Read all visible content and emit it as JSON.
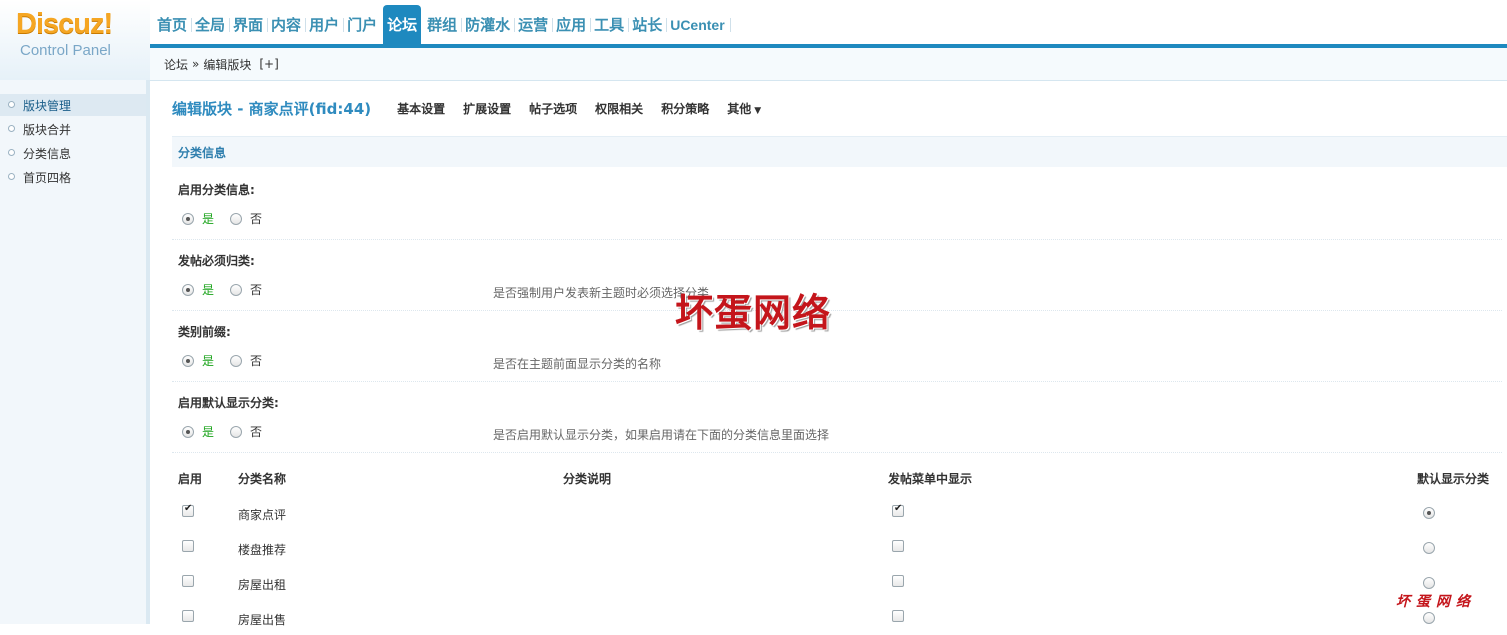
{
  "header": {
    "logo_text": "Discuz!",
    "logo_sub": "Control Panel",
    "nav": [
      "首页",
      "全局",
      "界面",
      "内容",
      "用户",
      "门户",
      "论坛",
      "群组",
      "防灌水",
      "运营",
      "应用",
      "工具",
      "站长",
      "UCenter"
    ],
    "active_nav": "论坛"
  },
  "breadcrumb": {
    "root": "论坛",
    "sep": "»",
    "current": "编辑版块",
    "plus": "[+]"
  },
  "sidebar": {
    "items": [
      "版块管理",
      "版块合并",
      "分类信息",
      "首页四格"
    ]
  },
  "main": {
    "title": "编辑版块 - 商家点评(fid:44)",
    "tabs": [
      "基本设置",
      "扩展设置",
      "帖子选项",
      "权限相关",
      "积分策略",
      "其他"
    ],
    "section": "分类信息",
    "yes": "是",
    "no": "否",
    "settings": [
      {
        "label": "启用分类信息:",
        "desc": ""
      },
      {
        "label": "发帖必须归类:",
        "desc": "是否强制用户发表新主题时必须选择分类"
      },
      {
        "label": "类别前缀:",
        "desc": "是否在主题前面显示分类的名称"
      },
      {
        "label": "启用默认显示分类:",
        "desc": "是否启用默认显示分类，如果启用请在下面的分类信息里面选择"
      }
    ],
    "table": {
      "headers": [
        "启用",
        "分类名称",
        "分类说明",
        "发帖菜单中显示",
        "默认显示分类"
      ],
      "rows": [
        {
          "enabled": true,
          "name": "商家点评",
          "menu": true,
          "default": true
        },
        {
          "enabled": false,
          "name": "楼盘推荐",
          "menu": false,
          "default": false
        },
        {
          "enabled": false,
          "name": "房屋出租",
          "menu": false,
          "default": false
        },
        {
          "enabled": false,
          "name": "房屋出售",
          "menu": false,
          "default": false
        }
      ]
    }
  },
  "watermark": "坏蛋网络",
  "watermark_small": "坏蛋网络"
}
